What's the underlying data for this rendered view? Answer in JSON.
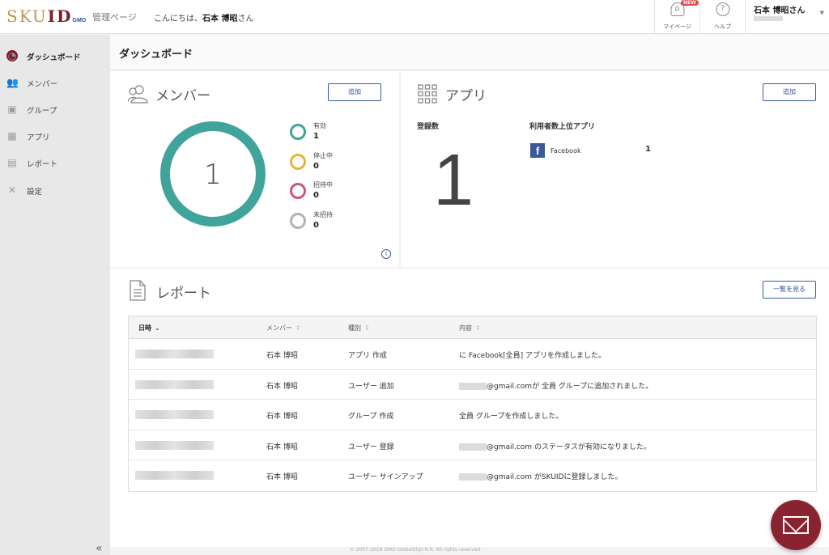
{
  "header": {
    "logo_sku": "SKU",
    "logo_id": "ID",
    "logo_gmo": "GMO",
    "admin_label": "管理ページ",
    "greeting_prefix": "こんにちは、",
    "greeting_name": "石本 博昭",
    "greeting_suffix": "さん",
    "mypage_label": "マイページ",
    "new_badge": "NEW",
    "help_label": "ヘルプ",
    "user_name": "石本 博昭さん"
  },
  "sidebar": {
    "items": [
      {
        "label": "ダッシュボード",
        "icon": "dashboard-icon"
      },
      {
        "label": "メンバー",
        "icon": "members-icon"
      },
      {
        "label": "グループ",
        "icon": "group-icon"
      },
      {
        "label": "アプリ",
        "icon": "apps-icon"
      },
      {
        "label": "レポート",
        "icon": "report-icon"
      },
      {
        "label": "設定",
        "icon": "settings-icon"
      }
    ],
    "collapse_label": "«"
  },
  "page_title": "ダッシュボード",
  "members": {
    "title": "メンバー",
    "add_label": "追加",
    "total": "1",
    "legend": [
      {
        "label": "有効",
        "value": "1",
        "color": "#41a49b"
      },
      {
        "label": "停止中",
        "value": "0",
        "color": "#e6b43c"
      },
      {
        "label": "招待中",
        "value": "0",
        "color": "#d0557a"
      },
      {
        "label": "未招待",
        "value": "0",
        "color": "#b3b3b3"
      }
    ]
  },
  "apps": {
    "title": "アプリ",
    "add_label": "追加",
    "registered_label": "登録数",
    "registered_count": "1",
    "top_label": "利用者数上位アプリ",
    "top_apps": [
      {
        "name": "Facebook",
        "count": "1"
      }
    ]
  },
  "report": {
    "title": "レポート",
    "view_all_label": "一覧を見る",
    "columns": [
      "日時",
      "メンバー",
      "種別",
      "内容"
    ],
    "rows": [
      {
        "member": "石本 博昭",
        "type": "アプリ 作成",
        "content": "に Facebook[全員] アプリを作成しました。"
      },
      {
        "member": "石本 博昭",
        "type": "ユーザー 追加",
        "content": "@gmail.comが 全員 グループに追加されました。"
      },
      {
        "member": "石本 博昭",
        "type": "グループ 作成",
        "content": "全員 グループを作成しました。"
      },
      {
        "member": "石本 博昭",
        "type": "ユーザー 登録",
        "content": "@gmail.com のステータスが有効になりました。"
      },
      {
        "member": "石本 博昭",
        "type": "ユーザー サインアップ",
        "content": "@gmail.com がSKUIDに登録しました。"
      }
    ]
  },
  "footer": "© 2007-2018 GMO GlobalSign K.K. All rights reserved."
}
